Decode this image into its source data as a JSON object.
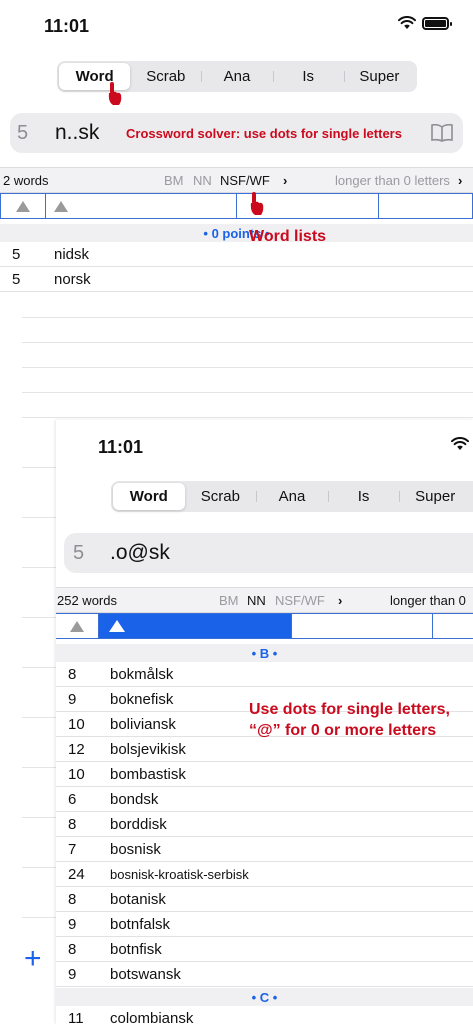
{
  "screen1": {
    "status": {
      "time": "11:01"
    },
    "segments": [
      "Word",
      "Scrab",
      "Ana",
      "Is",
      "Super"
    ],
    "selected_segment": "Word",
    "search": {
      "count": "5",
      "pattern": "n..sk",
      "hint": "Crossword solver: use dots for single letters"
    },
    "infobar": {
      "words": "2 words",
      "lists": [
        "BM",
        "NN",
        "NSF/WF"
      ],
      "active_list": "NSF/WF",
      "chevron": "›",
      "longer": "longer than 0 letters",
      "longer_chevron": "›"
    },
    "section": "• 0 points •",
    "lists_annotation": "Word lists",
    "rows": [
      {
        "len": "5",
        "word": "nidsk"
      },
      {
        "len": "5",
        "word": "norsk"
      }
    ]
  },
  "screen2": {
    "status": {
      "time": "11:01"
    },
    "segments": [
      "Word",
      "Scrab",
      "Ana",
      "Is",
      "Super"
    ],
    "selected_segment": "Word",
    "search": {
      "count": "5",
      "pattern": ".o@sk"
    },
    "infobar": {
      "words": "252 words",
      "lists": [
        "BM",
        "NN",
        "NSF/WF"
      ],
      "active_list": "NN",
      "chevron": "›",
      "longer": "longer than 0"
    },
    "annotation": {
      "line1": "Use dots for single letters,",
      "line2": "“@” for 0 or more letters"
    },
    "section_b": "• B •",
    "section_c": "• C •",
    "rows": [
      {
        "len": "8",
        "word": "bokmålsk"
      },
      {
        "len": "9",
        "word": "boknefisk"
      },
      {
        "len": "10",
        "word": "boliviansk"
      },
      {
        "len": "12",
        "word": "bolsjevikisk"
      },
      {
        "len": "10",
        "word": "bombastisk"
      },
      {
        "len": "6",
        "word": "bondsk"
      },
      {
        "len": "8",
        "word": "borddisk"
      },
      {
        "len": "7",
        "word": "bosnisk"
      },
      {
        "len": "24",
        "word": "bosnisk-kroatisk-serbisk"
      },
      {
        "len": "8",
        "word": "botanisk"
      },
      {
        "len": "9",
        "word": "botnfalsk"
      },
      {
        "len": "8",
        "word": "botnfisk"
      },
      {
        "len": "9",
        "word": "botswansk"
      }
    ],
    "rows_c": [
      {
        "len": "11",
        "word": "colombiansk"
      }
    ]
  },
  "add_button": "+",
  "colors": {
    "accent": "#1a63e8",
    "annotation": "#cc0a1e",
    "sort_selected": "#1a63e8"
  },
  "icons": [
    "wifi-icon",
    "battery-icon",
    "book-icon",
    "sort-ascending-icon",
    "hand-pointer-icon",
    "plus-icon"
  ]
}
